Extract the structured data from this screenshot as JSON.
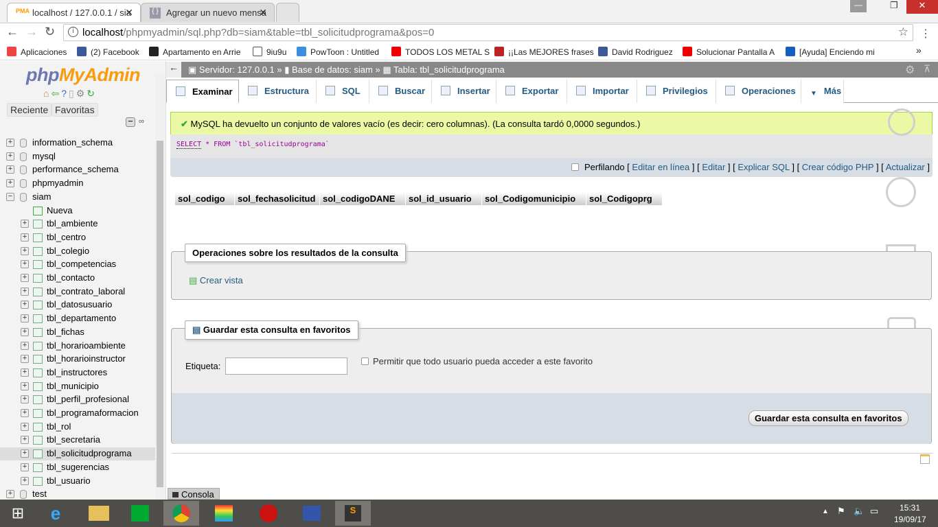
{
  "browser": {
    "tabs": [
      {
        "title": "localhost / 127.0.0.1 / sia"
      },
      {
        "title": "Agregar un nuevo mensa"
      }
    ],
    "url_host": "localhost",
    "url_path": "/phpmyadmin/sql.php?db=siam&table=tbl_solicitudprograma&pos=0",
    "bookmarks": [
      {
        "label": "Aplicaciones",
        "icon": "apps-icon",
        "color": "#e44"
      },
      {
        "label": "(2) Facebook",
        "icon": "facebook-icon",
        "color": "#3b5998"
      },
      {
        "label": "Apartamento en Arrie",
        "icon": "fr-icon",
        "color": "#222"
      },
      {
        "label": "9iu9u",
        "icon": "page-icon",
        "color": "#fff"
      },
      {
        "label": "PowToon : Untitled",
        "icon": "powtoon-icon",
        "color": "#3c8fde"
      },
      {
        "label": "TODOS LOS METAL S",
        "icon": "youtube-icon",
        "color": "#e00"
      },
      {
        "label": "¡¡Las MEJORES frases",
        "icon": "frases-icon",
        "color": "#b22"
      },
      {
        "label": "David Rodriguez",
        "icon": "facebook-icon",
        "color": "#3b5998"
      },
      {
        "label": "Solucionar Pantalla A",
        "icon": "youtube-icon",
        "color": "#e00"
      },
      {
        "label": "[Ayuda] Enciendo mi",
        "icon": "taringa-icon",
        "color": "#1560bd"
      }
    ],
    "more": "»"
  },
  "sidebar": {
    "logo_php": "php",
    "logo_myadmin": "MyAdmin",
    "recent": "Reciente",
    "favorites": "Favoritas",
    "databases": [
      "information_schema",
      "mysql",
      "performance_schema",
      "phpmyadmin",
      "siam"
    ],
    "siam_new": "Nueva",
    "tables": [
      "tbl_ambiente",
      "tbl_centro",
      "tbl_colegio",
      "tbl_competencias",
      "tbl_contacto",
      "tbl_contrato_laboral",
      "tbl_datosusuario",
      "tbl_departamento",
      "tbl_fichas",
      "tbl_horarioambiente",
      "tbl_horarioinstructor",
      "tbl_instructores",
      "tbl_municipio",
      "tbl_perfil_profesional",
      "tbl_programaformacion",
      "tbl_rol",
      "tbl_secretaria",
      "tbl_solicitudprograma",
      "tbl_sugerencias",
      "tbl_usuario"
    ],
    "selected_table": "tbl_solicitudprograma",
    "last_db": "test"
  },
  "breadcrumb": {
    "server": "Servidor: 127.0.0.1",
    "db": "Base de datos: siam",
    "table": "Tabla: tbl_solicitudprograma",
    "sep": "»"
  },
  "tabs": [
    {
      "label": "Examinar",
      "active": true
    },
    {
      "label": "Estructura"
    },
    {
      "label": "SQL"
    },
    {
      "label": "Buscar"
    },
    {
      "label": "Insertar"
    },
    {
      "label": "Exportar"
    },
    {
      "label": "Importar"
    },
    {
      "label": "Privilegios"
    },
    {
      "label": "Operaciones"
    },
    {
      "label": "Más"
    }
  ],
  "message": "MySQL ha devuelto un conjunto de valores vacío (es decir: cero columnas). (La consulta tardó 0,0000 segundos.)",
  "query": {
    "select": "SELECT",
    "rest": " * FROM `tbl_solicitudprograma`"
  },
  "actions": {
    "profiling": "Perfilando",
    "links": [
      "Editar en línea",
      "Editar",
      "Explicar SQL",
      "Crear código PHP",
      "Actualizar"
    ]
  },
  "columns": [
    "sol_codigo",
    "sol_fechasolicitud",
    "sol_codigoDANE",
    "sol_id_usuario",
    "sol_Codigomunicipio",
    "sol_Codigoprg"
  ],
  "operations": {
    "legend": "Operaciones sobre los resultados de la consulta",
    "create_view": "Crear vista"
  },
  "bookmark": {
    "legend": "Guardar esta consulta en favoritos",
    "label": "Etiqueta:",
    "label_value": "",
    "shared": "Permitir que todo usuario pueda acceder a este favorito",
    "submit": "Guardar esta consulta en favoritos"
  },
  "console": "Consola",
  "taskbar": {
    "time": "15:31",
    "date": "19/09/17"
  }
}
